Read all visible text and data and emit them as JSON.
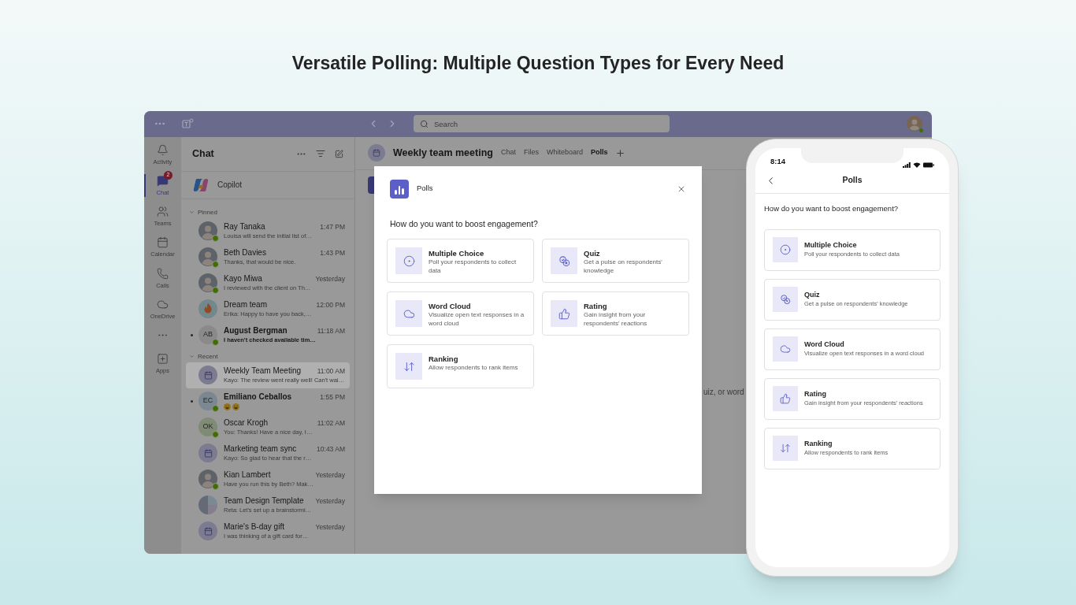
{
  "heading": "Versatile Polling: Multiple Question Types for Every Need",
  "app": {
    "title_bar": {
      "search_placeholder": "Search"
    },
    "rail": [
      {
        "kind": "activity",
        "label": "Activity",
        "selected": false
      },
      {
        "kind": "chat",
        "label": "Chat",
        "selected": true,
        "badge": "2"
      },
      {
        "kind": "teams",
        "label": "Teams",
        "selected": false
      },
      {
        "kind": "calendar",
        "label": "Calendar",
        "selected": false
      },
      {
        "kind": "calls",
        "label": "Calls",
        "selected": false
      },
      {
        "kind": "onedrive",
        "label": "OneDrive",
        "selected": false
      },
      {
        "kind": "more",
        "selected": false
      },
      {
        "kind": "apps",
        "label": "Apps",
        "selected": false
      }
    ],
    "chat_list": {
      "title": "Chat",
      "copilot": "Copilot",
      "sections": [
        {
          "label": "Pinned",
          "expanded": true,
          "chats": [
            {
              "name": "Ray Tanaka",
              "preview": "Louisa will send the initial list of…",
              "time": "1:47 PM",
              "avatar": {
                "kind": "photo"
              },
              "online": true,
              "unread": false,
              "selected": false
            },
            {
              "name": "Beth Davies",
              "preview": "Thanks, that would be nice.",
              "time": "1:43 PM",
              "avatar": {
                "kind": "photo"
              },
              "online": true,
              "unread": false,
              "selected": false
            },
            {
              "name": "Kayo Miwa",
              "preview": "I reviewed with the client on Th…",
              "time": "Yesterday",
              "avatar": {
                "kind": "photo"
              },
              "online": true,
              "unread": false,
              "selected": false
            },
            {
              "name": "Dream team",
              "preview": "Erika: Happy to have you back,…",
              "time": "12:00 PM",
              "avatar": {
                "kind": "flame"
              },
              "online": false,
              "unread": false,
              "selected": false
            },
            {
              "name": "August Bergman",
              "preview": "I haven't checked available tim…",
              "time": "11:18 AM",
              "avatar": {
                "kind": "initials",
                "initials": "AB",
                "color": "#8a8a8a"
              },
              "online": true,
              "unread": true,
              "selected": false
            }
          ]
        },
        {
          "label": "Recent",
          "expanded": true,
          "chats": [
            {
              "name": "Weekly Team Meeting",
              "preview": "Kayo: The review went really well! Can't wai…",
              "time": "11:00 AM",
              "avatar": {
                "kind": "meeting"
              },
              "online": false,
              "unread": false,
              "selected": true
            },
            {
              "name": "Emiliano Ceballos",
              "preview_icons": [
                {
                  "kind": "laughing"
                },
                {
                  "kind": "laughing"
                }
              ],
              "time": "1:55 PM",
              "avatar": {
                "kind": "initials",
                "initials": "EC",
                "color": "#7b8892"
              },
              "online": true,
              "unread": true,
              "selected": false
            },
            {
              "name": "Oscar Krogh",
              "preview": "You: Thanks! Have a nice day, I…",
              "time": "11:02 AM",
              "avatar": {
                "kind": "initials",
                "initials": "OK",
                "color": "#808b76"
              },
              "online": true,
              "unread": false,
              "selected": false
            },
            {
              "name": "Marketing team sync",
              "preview": "Kayo: So glad to hear that the r…",
              "time": "10:43 AM",
              "avatar": {
                "kind": "meeting"
              },
              "online": false,
              "unread": false,
              "selected": false
            },
            {
              "name": "Kian Lambert",
              "preview": "Have you run this by Beth? Mak…",
              "time": "Yesterday",
              "avatar": {
                "kind": "photo"
              },
              "online": true,
              "unread": false,
              "selected": false
            },
            {
              "name": "Team Design Template",
              "preview": "Reta: Let's set up a brainstormi…",
              "time": "Yesterday",
              "avatar": {
                "kind": "group"
              },
              "online": false,
              "unread": false,
              "selected": false
            },
            {
              "name": "Marie's B-day gift",
              "preview": "I was thinking of a gift card for…",
              "time": "Yesterday",
              "avatar": {
                "kind": "meeting"
              },
              "online": false,
              "unread": false,
              "selected": false
            }
          ]
        }
      ]
    },
    "meeting": {
      "title": "Weekly team meeting",
      "tabs": [
        {
          "label": "Chat",
          "selected": false
        },
        {
          "label": "Files",
          "selected": false
        },
        {
          "label": "Whiteboard",
          "selected": false
        },
        {
          "label": "Polls",
          "selected": true
        }
      ],
      "body_text": "uiz, or word"
    },
    "dialog": {
      "title": "Polls",
      "question": "How do you want to boost engagement?",
      "options": [
        {
          "kind": "multiple_choice",
          "title": "Multiple Choice",
          "description": "Poll your respondents to collect data"
        },
        {
          "kind": "quiz",
          "title": "Quiz",
          "description": "Get a pulse on respondents' knowledge"
        },
        {
          "kind": "word_cloud",
          "title": "Word Cloud",
          "description": "Visualize open text responses in a word cloud"
        },
        {
          "kind": "rating",
          "title": "Rating",
          "description": "Gain insight from your respondents' reactions"
        },
        {
          "kind": "ranking",
          "title": "Ranking",
          "description": "Allow respondents to rank items"
        }
      ]
    }
  },
  "phone": {
    "time": "8:14",
    "title": "Polls",
    "question": "How do you want to boost engagement?",
    "options": [
      {
        "kind": "multiple_choice",
        "title": "Multiple Choice",
        "description": "Poll your respondents to collect data"
      },
      {
        "kind": "quiz",
        "title": "Quiz",
        "description": "Get a pulse on respondents' knowledge"
      },
      {
        "kind": "word_cloud",
        "title": "Word Cloud",
        "description": "Visualize open text responses in a word cloud"
      },
      {
        "kind": "rating",
        "title": "Rating",
        "description": "Gain insight from your respondents' reactions"
      },
      {
        "kind": "ranking",
        "title": "Ranking",
        "description": "Allow respondents to rank items"
      }
    ]
  }
}
